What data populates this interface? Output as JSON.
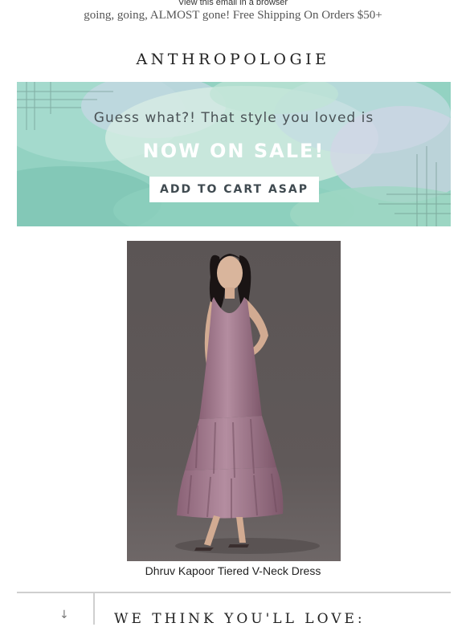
{
  "header": {
    "view_link": "View this email in a browser",
    "promo": "going, going, ALMOST gone! Free Shipping On Orders $50+",
    "brand": "ANTHROPOLOGIE"
  },
  "banner": {
    "line1": "Guess what?! That style you loved is",
    "line2": "NOW ON SALE!",
    "cta": "ADD TO CART ASAP"
  },
  "product": {
    "name": "Dhruv Kapoor Tiered V-Neck Dress"
  },
  "section": {
    "arrow": "↓",
    "title": "WE THINK YOU'LL LOVE:"
  },
  "colors": {
    "banner_bg": "#8fd0c0",
    "dress": "#a77a8f",
    "photo_bg": "#5f5858"
  }
}
